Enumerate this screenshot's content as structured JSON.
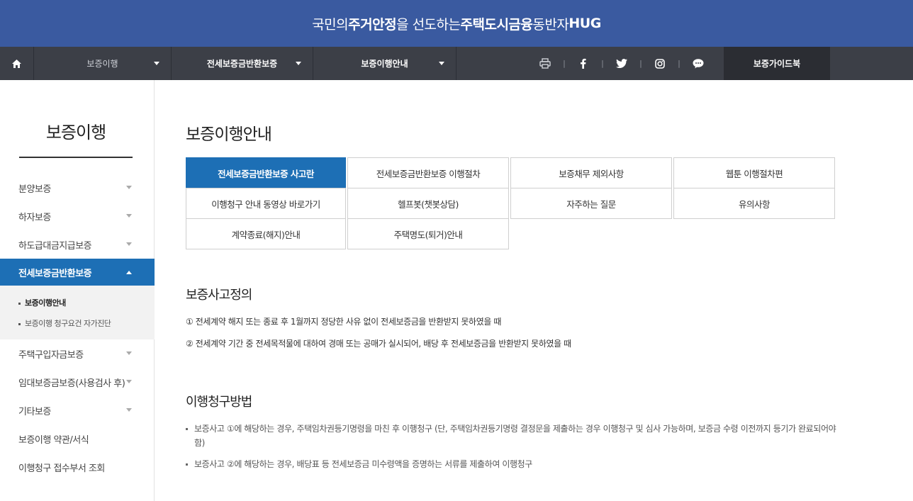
{
  "banner": {
    "part1": "국민의 ",
    "part2": "주거안정",
    "part3": "을 선도하는 ",
    "part4": "주택도시금융",
    "part5": " 동반자 ",
    "part6": "HUG"
  },
  "nav": {
    "menu1": "보증이행",
    "menu2": "전세보증금반환보증",
    "menu3": "보증이행안내",
    "guide": "보증가이드북",
    "sep": "|"
  },
  "sidebar": {
    "title": "보증이행",
    "items": [
      {
        "label": "분양보증"
      },
      {
        "label": "하자보증"
      },
      {
        "label": "하도급대금지급보증"
      },
      {
        "label": "전세보증금반환보증"
      },
      {
        "label": "주택구입자금보증"
      },
      {
        "label": "임대보증금보증(사용검사 후)"
      },
      {
        "label": "기타보증"
      },
      {
        "label": "보증이행 약관/서식"
      },
      {
        "label": "이행청구 접수부서 조회"
      }
    ],
    "sub": [
      "보증이행안내",
      "보증이행 청구요건 자가진단"
    ]
  },
  "main": {
    "title": "보증이행안내",
    "tabs": [
      "전세보증금반환보증 사고란",
      "전세보증금반환보증 이행절차",
      "보증채무 제외사항",
      "웹툰 이행절차편",
      "이행청구 안내 동영상 바로가기",
      "헬프봇(챗봇상담)",
      "자주하는 질문",
      "유의사항",
      "계약종료(해지)안내",
      "주택명도(퇴거)안내"
    ],
    "section1": {
      "heading": "보증사고정의",
      "items": [
        "① 전세계약 해지 또는 종료 후 1월까지 정당한 사유 없이 전세보증금을 반환받지 못하였을 때",
        "② 전세계약 기간 중 전세목적물에 대하여 경매 또는 공매가 실시되어, 배당 후 전세보증금을 반환받지 못하였을 때"
      ]
    },
    "section2": {
      "heading": "이행청구방법",
      "items": [
        "보증사고 ①에 해당하는 경우, 주택임차권등기명령을 마친 후 이행청구 (단, 주택임차권등기명령 결정문을 제출하는 경우 이행청구 및 심사 가능하며, 보증금 수령 이전까지 등기가 완료되어야 함)",
        "보증사고 ②에 해당하는 경우, 배당표 등 전세보증금 미수령액을 증명하는 서류를 제출하여 이행청구"
      ]
    }
  },
  "colors": {
    "banner": "#3a5aa0",
    "nav": "#3c3f47",
    "accent": "#1d6fb5"
  }
}
